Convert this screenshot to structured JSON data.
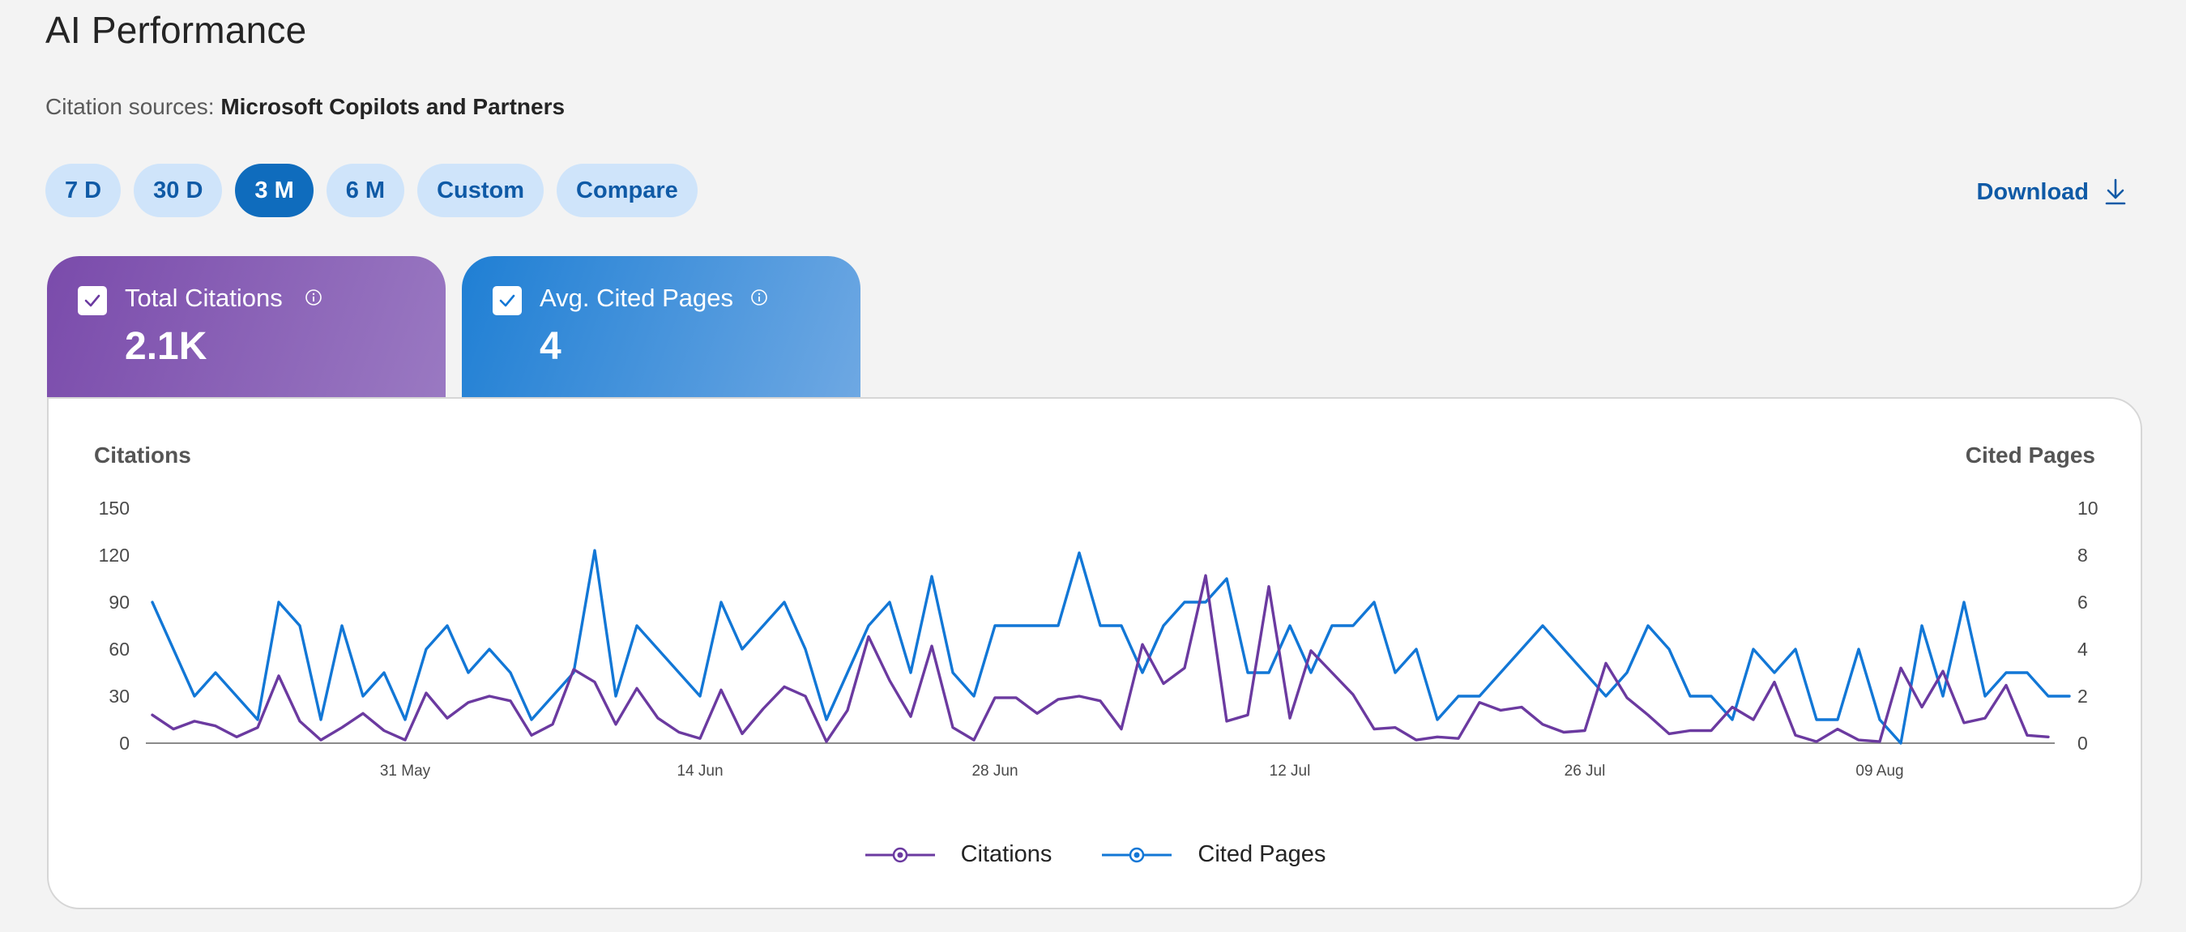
{
  "page": {
    "title": "AI Performance",
    "sources_label": "Citation sources:",
    "sources_value": "Microsoft Copilots and Partners"
  },
  "ranges": [
    {
      "label": "7 D",
      "active": false
    },
    {
      "label": "30 D",
      "active": false
    },
    {
      "label": "3 M",
      "active": true
    },
    {
      "label": "6 M",
      "active": false
    },
    {
      "label": "Custom",
      "active": false
    },
    {
      "label": "Compare",
      "active": false
    }
  ],
  "download_label": "Download",
  "tiles": {
    "citations": {
      "label": "Total Citations",
      "value": "2.1K",
      "checked": true
    },
    "cited_pages": {
      "label": "Avg. Cited Pages",
      "value": "4",
      "checked": true
    }
  },
  "colors": {
    "citations": "#6b3aa0",
    "cited_pages": "#1277d6",
    "accent": "#0f6cbd"
  },
  "chart_data": {
    "type": "line",
    "left_axis": {
      "title": "Citations",
      "ticks": [
        0,
        30,
        60,
        90,
        120,
        150
      ],
      "range": [
        0,
        150
      ]
    },
    "right_axis": {
      "title": "Cited Pages",
      "ticks": [
        0,
        2,
        4,
        6,
        8,
        10
      ],
      "range": [
        0,
        10
      ]
    },
    "x_ticks": [
      {
        "label": "31 May",
        "day": 12
      },
      {
        "label": "14 Jun",
        "day": 26
      },
      {
        "label": "28 Jun",
        "day": 40
      },
      {
        "label": "12 Jul",
        "day": 54
      },
      {
        "label": "26 Jul",
        "day": 68
      },
      {
        "label": "09 Aug",
        "day": 82
      }
    ],
    "series": [
      {
        "name": "Citations",
        "axis": "left",
        "values": [
          18,
          9,
          14,
          11,
          4,
          10,
          43,
          14,
          2,
          10,
          19,
          8,
          2,
          32,
          16,
          26,
          30,
          27,
          5,
          12,
          47,
          39,
          12,
          35,
          16,
          7,
          3,
          34,
          6,
          22,
          36,
          30,
          1,
          21,
          68,
          40,
          17,
          62,
          10,
          2,
          29,
          29,
          19,
          28,
          30,
          27,
          9,
          63,
          38,
          48,
          107,
          14,
          18,
          100,
          16,
          59,
          45,
          31,
          9,
          10,
          2,
          4,
          3,
          26,
          21,
          23,
          12,
          7,
          8,
          51,
          29,
          18,
          6,
          8,
          8,
          23,
          15,
          39,
          5,
          1,
          9,
          2,
          1,
          48,
          23,
          46,
          13,
          16,
          37,
          5,
          4
        ]
      },
      {
        "name": "Cited Pages",
        "axis": "right",
        "values": [
          6,
          4,
          2,
          3,
          2,
          1,
          6,
          5,
          1,
          5,
          2,
          3,
          1,
          4,
          5,
          3,
          4,
          3,
          1,
          2,
          3,
          8.2,
          2,
          5,
          4,
          3,
          2,
          6,
          4,
          5,
          6,
          4,
          1,
          3,
          5,
          6,
          3,
          7.1,
          3,
          2,
          5,
          5,
          5,
          5,
          8.1,
          5,
          5,
          3,
          5,
          6,
          6,
          7,
          3,
          3,
          5,
          3,
          5,
          5,
          6,
          3,
          4,
          1,
          2,
          2,
          3,
          4,
          5,
          4,
          3,
          2,
          3,
          5,
          4,
          2,
          2,
          1,
          4,
          3,
          4,
          1,
          1,
          4,
          1,
          0,
          5,
          2,
          6,
          2,
          3,
          3,
          2,
          2
        ]
      }
    ],
    "legend": [
      "Citations",
      "Cited Pages"
    ],
    "legend_position": "bottom-center",
    "grid": false
  }
}
